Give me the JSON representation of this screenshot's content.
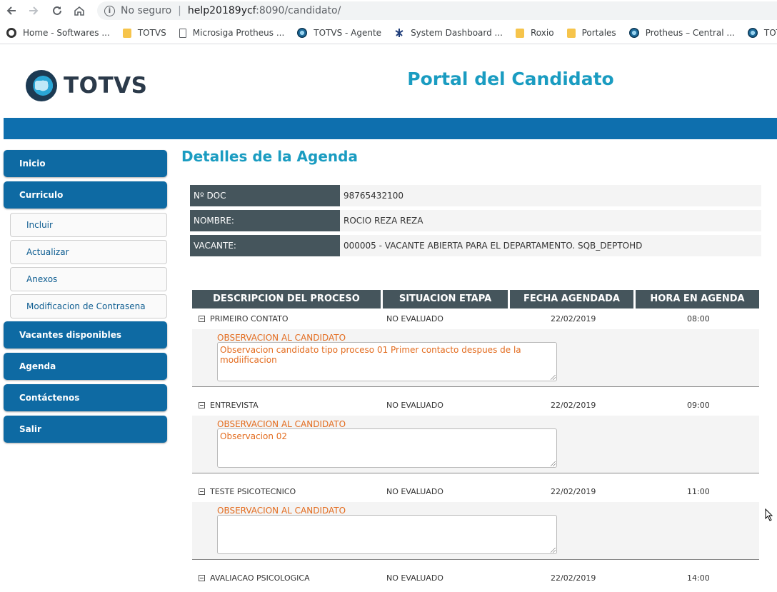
{
  "browser": {
    "security_text": "No seguro",
    "url_host": "help20189ycf",
    "url_rest": ":8090/candidato/",
    "bookmarks": [
      {
        "label": "Home - Softwares ...",
        "icon": "home-icon"
      },
      {
        "label": "TOTVS",
        "icon": "folder-icon"
      },
      {
        "label": "Microsiga Protheus ...",
        "icon": "page-icon"
      },
      {
        "label": "TOTVS - Agente",
        "icon": "totvs-icon"
      },
      {
        "label": "System Dashboard ...",
        "icon": "dashboard-icon"
      },
      {
        "label": "Roxio",
        "icon": "folder-icon"
      },
      {
        "label": "Portales",
        "icon": "folder-icon"
      },
      {
        "label": "Protheus – Central ...",
        "icon": "totvs-icon"
      },
      {
        "label": "TOTVS CST",
        "icon": "totvs-icon"
      }
    ]
  },
  "header": {
    "logo_text": "TOTVS",
    "portal_title": "Portal del Candidato"
  },
  "sidebar": {
    "inicio": "Inicio",
    "curriculo": "Curriculo",
    "sub": [
      "Incluir",
      "Actualizar",
      "Anexos",
      "Modificacion de Contrasena"
    ],
    "vacantes": "Vacantes disponibles",
    "agenda": "Agenda",
    "contactenos": "Contáctenos",
    "salir": "Salir"
  },
  "main": {
    "title": "Detalles de la Agenda",
    "info": {
      "doc_label": "Nº DOC",
      "doc_value": "98765432100",
      "nombre_label": "NOMBRE:",
      "nombre_value": "ROCIO REZA REZA",
      "vacante_label": "VACANTE:",
      "vacante_value": "000005 - VACANTE ABIERTA PARA EL DEPARTAMENTO. SQB_DEPTOHD"
    },
    "columns": [
      "DESCRIPCION DEL PROCESO",
      "SITUACION ETAPA",
      "FECHA AGENDADA",
      "HORA EN AGENDA"
    ],
    "obs_label": "OBSERVACION AL CANDIDATO",
    "processes": [
      {
        "desc": "PRIMEIRO CONTATO",
        "status": "NO EVALUADO",
        "date": "22/02/2019",
        "time": "08:00",
        "obs": "Observacion candidato tipo proceso 01 Primer contacto despues de la modiificacion"
      },
      {
        "desc": "ENTREVISTA",
        "status": "NO EVALUADO",
        "date": "22/02/2019",
        "time": "09:00",
        "obs": "Observacion 02"
      },
      {
        "desc": "TESTE PSICOTECNICO",
        "status": "NO EVALUADO",
        "date": "22/02/2019",
        "time": "11:00",
        "obs": ""
      },
      {
        "desc": "AVALIACAO PSICOLOGICA",
        "status": "NO EVALUADO",
        "date": "22/02/2019",
        "time": "14:00",
        "obs": ""
      }
    ]
  },
  "colors": {
    "accent": "#1a9cc1",
    "band": "#0e6fae",
    "menu": "#0e6aa3",
    "label_bg": "#45555c",
    "obs": "#e36c1f"
  }
}
